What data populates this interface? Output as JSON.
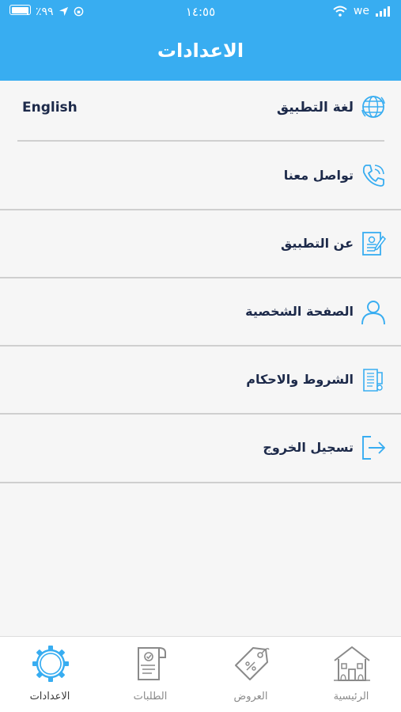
{
  "status_bar": {
    "battery": "٪٩٩",
    "time": "١٤:٥٥",
    "carrier": "we"
  },
  "header": {
    "title": "الاعدادات"
  },
  "settings": {
    "language": {
      "label": "لغة التطبيق",
      "value": "English"
    },
    "items": [
      {
        "label": "تواصل معنا",
        "icon": "phone-icon"
      },
      {
        "label": "عن التطبيق",
        "icon": "document-edit-icon"
      },
      {
        "label": "الصفحة الشخصية",
        "icon": "user-icon"
      },
      {
        "label": "الشروط والاحكام",
        "icon": "terms-icon"
      },
      {
        "label": "تسجيل الخروج",
        "icon": "logout-icon"
      }
    ]
  },
  "tabbar": {
    "tabs": [
      {
        "label": "الرئيسية",
        "icon": "house-icon"
      },
      {
        "label": "العروض",
        "icon": "price-tag-icon"
      },
      {
        "label": "الطلبات",
        "icon": "orders-icon"
      },
      {
        "label": "الاعدادات",
        "icon": "gear-icon",
        "active": true
      }
    ]
  },
  "colors": {
    "primary": "#38adf1",
    "text": "#1d2a4a",
    "divider": "#cfcfcf",
    "inactive": "#8a8a8a"
  }
}
